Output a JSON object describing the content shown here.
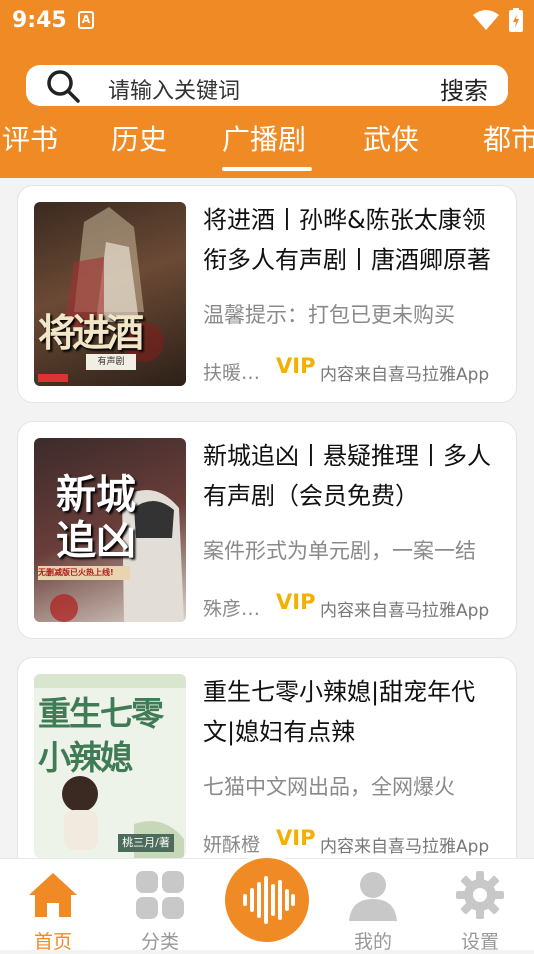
{
  "status": {
    "time": "9:45",
    "notif_icon": "a-notification-icon",
    "wifi_icon": "wifi-icon",
    "battery_icon": "battery-charging-icon"
  },
  "search": {
    "placeholder": "请输入关键词",
    "button": "搜索"
  },
  "tabs": [
    {
      "label": "评书",
      "active": false
    },
    {
      "label": "历史",
      "active": false
    },
    {
      "label": "广播剧",
      "active": true
    },
    {
      "label": "武侠",
      "active": false
    },
    {
      "label": "都市",
      "active": false
    }
  ],
  "items": [
    {
      "title": "将进酒丨孙晔&陈张太康领衔多人有声剧丨唐酒卿原著",
      "desc": "温馨提示：打包已更未购买",
      "author": "扶暖文化",
      "vip": "VIP",
      "source": "内容来自喜马拉雅App",
      "cover_text": "将进酒",
      "cover_sub": "有声剧"
    },
    {
      "title": "新城追凶丨悬疑推理丨多人有声剧（会员免费）",
      "desc": "案件形式为单元剧，一案一结",
      "author": "殊彦文化",
      "vip": "VIP",
      "source": "内容来自喜马拉雅App",
      "cover_text": "新城追凶",
      "cover_sub": "无删减版已火热上线!"
    },
    {
      "title": "重生七零小辣媳|甜宠年代文|媳妇有点辣",
      "desc": "七猫中文网出品，全网爆火",
      "author": "妍酥橙",
      "vip": "VIP",
      "source": "内容来自喜马拉雅App",
      "cover_text": "重生七零小辣媳",
      "cover_sub": "桃三月/著"
    }
  ],
  "nav": [
    {
      "label": "首页",
      "icon": "home-icon",
      "active": true
    },
    {
      "label": "分类",
      "icon": "category-grid-icon",
      "active": false
    },
    {
      "label": "",
      "icon": "audio-wave-icon",
      "active": false
    },
    {
      "label": "我的",
      "icon": "user-icon",
      "active": false
    },
    {
      "label": "设置",
      "icon": "gear-icon",
      "active": false
    }
  ],
  "colors": {
    "brand": "#f08a24",
    "vip": "#f3b000"
  }
}
